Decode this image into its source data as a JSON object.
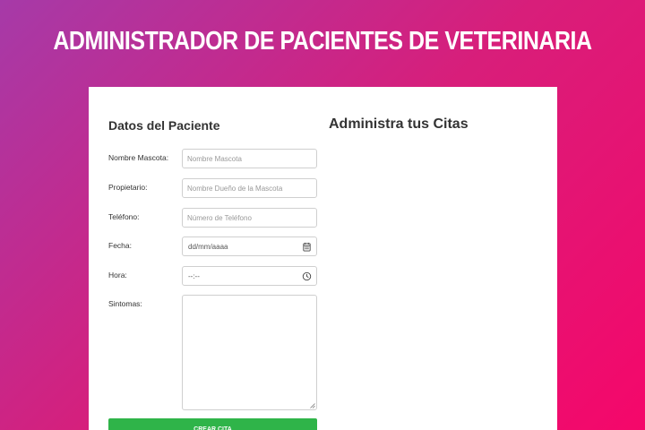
{
  "header": {
    "title": "ADMINISTRADOR DE PACIENTES DE VETERINARIA"
  },
  "form": {
    "heading": "Datos del Paciente",
    "fields": {
      "mascota": {
        "label": "Nombre Mascota:",
        "placeholder": "Nombre Mascota"
      },
      "propietario": {
        "label": "Propietario:",
        "placeholder": "Nombre Dueño de la Mascota"
      },
      "telefono": {
        "label": "Teléfono:",
        "placeholder": "Número de Teléfono"
      },
      "fecha": {
        "label": "Fecha:",
        "value": "dd/mm/aaaa",
        "icon": "calendar-icon"
      },
      "hora": {
        "label": "Hora:",
        "value": "--:--",
        "icon": "clock-icon"
      },
      "sintomas": {
        "label": "Sintomas:"
      }
    },
    "submit_label": "CREAR CITA"
  },
  "appointments": {
    "heading": "Administra tus Citas"
  },
  "colors": {
    "gradient_start": "#a63aa8",
    "gradient_end": "#f5076a",
    "card": "#ffffff",
    "submit": "#2fb449"
  }
}
